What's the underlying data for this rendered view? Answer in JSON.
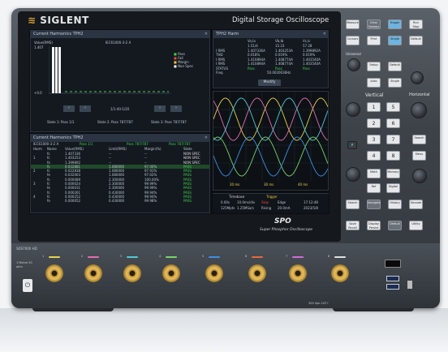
{
  "brand": "SIGLENT",
  "model_title": "Digital Storage Oscilloscope",
  "spo": {
    "logo": "SPO",
    "subtitle": "Super Phosphor Oscilloscope"
  },
  "harmonics": {
    "title": "Current Harmonics TPH2",
    "ylabel": "Value(RMS)",
    "ytop": "1.407",
    "ybottom": "+0.0",
    "standard": "IEC61000-3-2 A",
    "legend": [
      "Pass",
      "Fail",
      "Margin",
      "Non Spec"
    ],
    "nav_label": "1/1:40:1/20",
    "states": [
      "State 1: Pass 1/1",
      "State 2: Pass 787/787",
      "State 3: Pass 787/787"
    ]
  },
  "table": {
    "title": "Current Harmonics TPH2",
    "subheader": [
      "IEC61000-3-2 A",
      "Pass 1/1",
      "Pass 787/787",
      "Pass 787/787"
    ],
    "columns": [
      "Harm",
      "Name",
      "Value(RMS)",
      "Limit(RMS)",
      "Margin(%)",
      "State"
    ],
    "rows": [
      [
        "",
        "fs",
        "1.407336",
        "--",
        "--",
        "NON SPEC"
      ],
      [
        "1",
        "fc",
        "1.403253",
        "--",
        "--",
        "NON SPEC"
      ],
      [
        "",
        "fe",
        "1.399892",
        "--",
        "--",
        "NON SPEC"
      ],
      [
        "",
        "fs",
        "0.032881",
        "1.080000",
        "97.00%",
        "PASS"
      ],
      [
        "2",
        "fc",
        "0.022838",
        "1.080000",
        "97.91%",
        "PASS"
      ],
      [
        "",
        "fe",
        "0.032003",
        "1.080000",
        "97.02%",
        "PASS"
      ],
      [
        "",
        "fs",
        "0.000089",
        "2.300000",
        "100.00%",
        "PASS"
      ],
      [
        "3",
        "fc",
        "0.000024",
        "2.300000",
        "99.99%",
        "PASS"
      ],
      [
        "",
        "fe",
        "0.000031",
        "2.300000",
        "99.99%",
        "PASS"
      ],
      [
        "",
        "fs",
        "0.000261",
        "0.430000",
        "99.94%",
        "PASS"
      ],
      [
        "4",
        "fc",
        "0.000252",
        "0.430000",
        "99.94%",
        "PASS"
      ],
      [
        "",
        "fe",
        "0.000052",
        "0.430000",
        "99.98%",
        "PASS"
      ]
    ]
  },
  "measure": {
    "title": "TPH2 Harm",
    "cols": [
      "",
      "Va,Ia",
      "Vb,Ib",
      "Vc,Ic"
    ],
    "rows": [
      [
        "",
        "1.51/4",
        "15.23",
        "57.28"
      ],
      [
        "I RMS",
        "1.407336A",
        "1.403253A",
        "1.399892A"
      ],
      [
        "THD",
        "0.018%",
        "0.019%",
        "0.019%"
      ],
      [
        "I RMS",
        "1.410894A",
        "1.408774A",
        "1.403540A"
      ],
      [
        "I RMS",
        "1.410894A",
        "1.408774A",
        "1.403540A"
      ],
      [
        "STATUS",
        "Pass",
        "Pass",
        "Pass"
      ]
    ],
    "freq_label": "Freq",
    "freq": "50.0020036Hz",
    "modify": "Modify"
  },
  "waveform": {
    "tick_labels": [
      "20 ms",
      "30 ms",
      "40 ms"
    ]
  },
  "bottom_bar": {
    "timebase_label": "Timebase",
    "timebase": "0.00s",
    "tdiv": "10.0ms/div",
    "srate": "125Mpts",
    "srate2": "1.25MSa/s",
    "trigger_label": "Trigger",
    "trig_state": "Stop",
    "trig_mode": "Edge",
    "trig_level": "20.0mA",
    "trig_slope": "Rising",
    "time": "17:12:48",
    "date": "2023/5/8"
  },
  "buttons": {
    "measure": "Measure",
    "cursors": "Cursors",
    "search": "Search",
    "navigate": "Navigate",
    "history": "History",
    "decode": "Decode",
    "auto": "Auto",
    "setup": "Setup",
    "default": "Default",
    "clear": "Clear Sweeps",
    "trigger": "Trigger",
    "single": "Single",
    "run": "Run Stop",
    "print": "Print",
    "math": "Math",
    "ref": "Ref",
    "memory": "Memory",
    "digital": "Digital",
    "menu": "Menu",
    "intensity": "Intensity",
    "save": "Save Recall",
    "display": "Display Persist",
    "utility": "Utility",
    "ch1": "1",
    "ch2": "2",
    "ch3": "3",
    "ch4": "4",
    "ch5": "5",
    "ch6": "6",
    "ch7": "7",
    "ch8": "8",
    "vertical": "Vertical",
    "horizontal": "Horizontal",
    "universal": "Universal",
    "zoom": "Zoom"
  },
  "channels": {
    "labels": [
      "1",
      "2",
      "3",
      "4",
      "5",
      "6",
      "7",
      "8"
    ],
    "colors": [
      "#e6d44b",
      "#e26fb0",
      "#53c8d6",
      "#7ad46a",
      "#3e8fe0",
      "#e36a3b",
      "#d06cd8",
      "#e0e0e0"
    ]
  },
  "front": {
    "model": "SDS7000 HD",
    "input_spec": "1 Mohm 50 ohm",
    "warning": "300 Vpk CAT I"
  }
}
